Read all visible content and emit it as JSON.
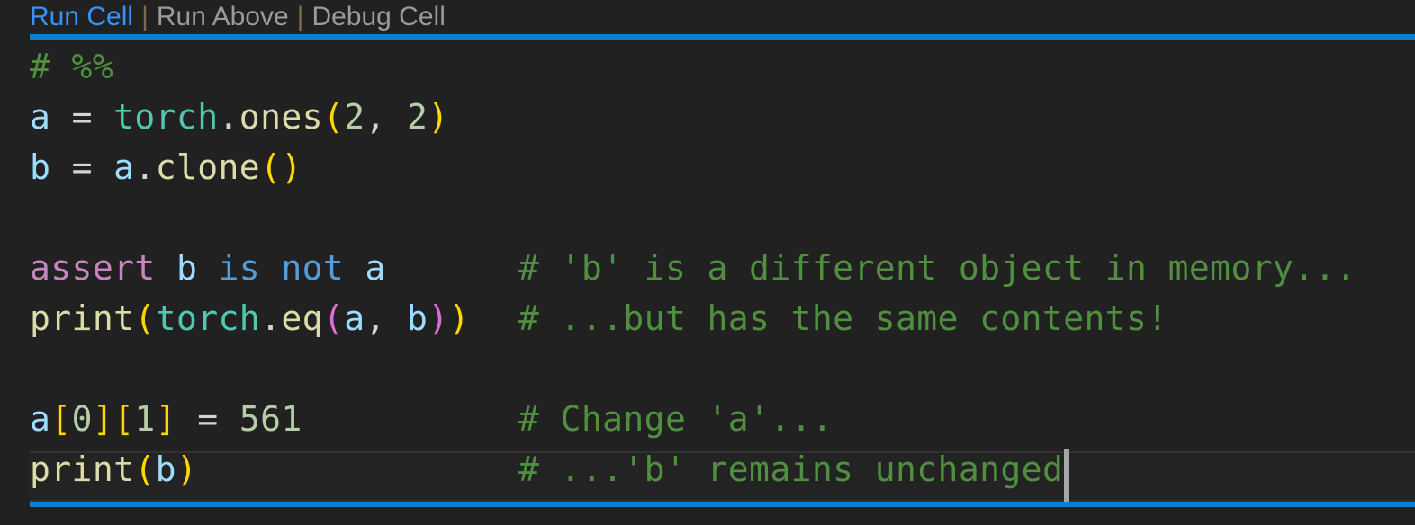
{
  "editor": {
    "background_color": "#212121",
    "cell_rule_color": "#0f7ecb",
    "caret_color": "#a6a6a6"
  },
  "codelens": {
    "run_cell": "Run Cell",
    "run_above": "Run Above",
    "debug_cell": "Debug Cell",
    "separator": "|",
    "link_color": "#3794ff",
    "dim_color": "#9b9b9b"
  },
  "code": {
    "language": "python",
    "lines": [
      {
        "index": 1,
        "text": "# %%",
        "tokens": [
          {
            "t": "# %%",
            "c": "t-comment"
          }
        ],
        "comment": ""
      },
      {
        "index": 2,
        "text": "a = torch.ones(2, 2)",
        "tokens": [
          {
            "t": "a",
            "c": "t-var"
          },
          {
            "t": " ",
            "c": "t-plain"
          },
          {
            "t": "=",
            "c": "t-plain"
          },
          {
            "t": " ",
            "c": "t-plain"
          },
          {
            "t": "torch",
            "c": "t-class"
          },
          {
            "t": ".",
            "c": "t-dot"
          },
          {
            "t": "ones",
            "c": "t-func"
          },
          {
            "t": "(",
            "c": "t-br1"
          },
          {
            "t": "2",
            "c": "t-number"
          },
          {
            "t": ",",
            "c": "t-plain"
          },
          {
            "t": " ",
            "c": "t-plain"
          },
          {
            "t": "2",
            "c": "t-number"
          },
          {
            "t": ")",
            "c": "t-br1"
          }
        ],
        "comment": ""
      },
      {
        "index": 3,
        "text": "b = a.clone()",
        "tokens": [
          {
            "t": "b",
            "c": "t-var"
          },
          {
            "t": " ",
            "c": "t-plain"
          },
          {
            "t": "=",
            "c": "t-plain"
          },
          {
            "t": " ",
            "c": "t-plain"
          },
          {
            "t": "a",
            "c": "t-var"
          },
          {
            "t": ".",
            "c": "t-dot"
          },
          {
            "t": "clone",
            "c": "t-func"
          },
          {
            "t": "(",
            "c": "t-br1"
          },
          {
            "t": ")",
            "c": "t-br1"
          }
        ],
        "comment": ""
      },
      {
        "index": 4,
        "text": "",
        "tokens": [],
        "comment": ""
      },
      {
        "index": 5,
        "text": "assert b is not a",
        "tokens": [
          {
            "t": "assert",
            "c": "t-keyword"
          },
          {
            "t": " ",
            "c": "t-plain"
          },
          {
            "t": "b",
            "c": "t-var"
          },
          {
            "t": " ",
            "c": "t-plain"
          },
          {
            "t": "is",
            "c": "t-control"
          },
          {
            "t": " ",
            "c": "t-plain"
          },
          {
            "t": "not",
            "c": "t-control"
          },
          {
            "t": " ",
            "c": "t-plain"
          },
          {
            "t": "a",
            "c": "t-var"
          }
        ],
        "comment": "# 'b' is a different object in memory..."
      },
      {
        "index": 6,
        "text": "print(torch.eq(a, b))",
        "tokens": [
          {
            "t": "print",
            "c": "t-func"
          },
          {
            "t": "(",
            "c": "t-br1"
          },
          {
            "t": "torch",
            "c": "t-class"
          },
          {
            "t": ".",
            "c": "t-dot"
          },
          {
            "t": "eq",
            "c": "t-func"
          },
          {
            "t": "(",
            "c": "t-br2"
          },
          {
            "t": "a",
            "c": "t-var"
          },
          {
            "t": ",",
            "c": "t-plain"
          },
          {
            "t": " ",
            "c": "t-plain"
          },
          {
            "t": "b",
            "c": "t-var"
          },
          {
            "t": ")",
            "c": "t-br2"
          },
          {
            "t": ")",
            "c": "t-br1"
          }
        ],
        "comment": "# ...but has the same contents!"
      },
      {
        "index": 7,
        "text": "",
        "tokens": [],
        "comment": ""
      },
      {
        "index": 8,
        "text": "a[0][1] = 561",
        "tokens": [
          {
            "t": "a",
            "c": "t-var"
          },
          {
            "t": "[",
            "c": "t-br1"
          },
          {
            "t": "0",
            "c": "t-number"
          },
          {
            "t": "]",
            "c": "t-br1"
          },
          {
            "t": "[",
            "c": "t-br1"
          },
          {
            "t": "1",
            "c": "t-number"
          },
          {
            "t": "]",
            "c": "t-br1"
          },
          {
            "t": " ",
            "c": "t-plain"
          },
          {
            "t": "=",
            "c": "t-plain"
          },
          {
            "t": " ",
            "c": "t-plain"
          },
          {
            "t": "561",
            "c": "t-number"
          }
        ],
        "comment": "# Change 'a'..."
      },
      {
        "index": 9,
        "text": "print(b)",
        "current": true,
        "tokens": [
          {
            "t": "print",
            "c": "t-func"
          },
          {
            "t": "(",
            "c": "t-br1"
          },
          {
            "t": "b",
            "c": "t-var"
          },
          {
            "t": ")",
            "c": "t-br1"
          }
        ],
        "comment": "# ...'b' remains unchanged"
      }
    ]
  }
}
